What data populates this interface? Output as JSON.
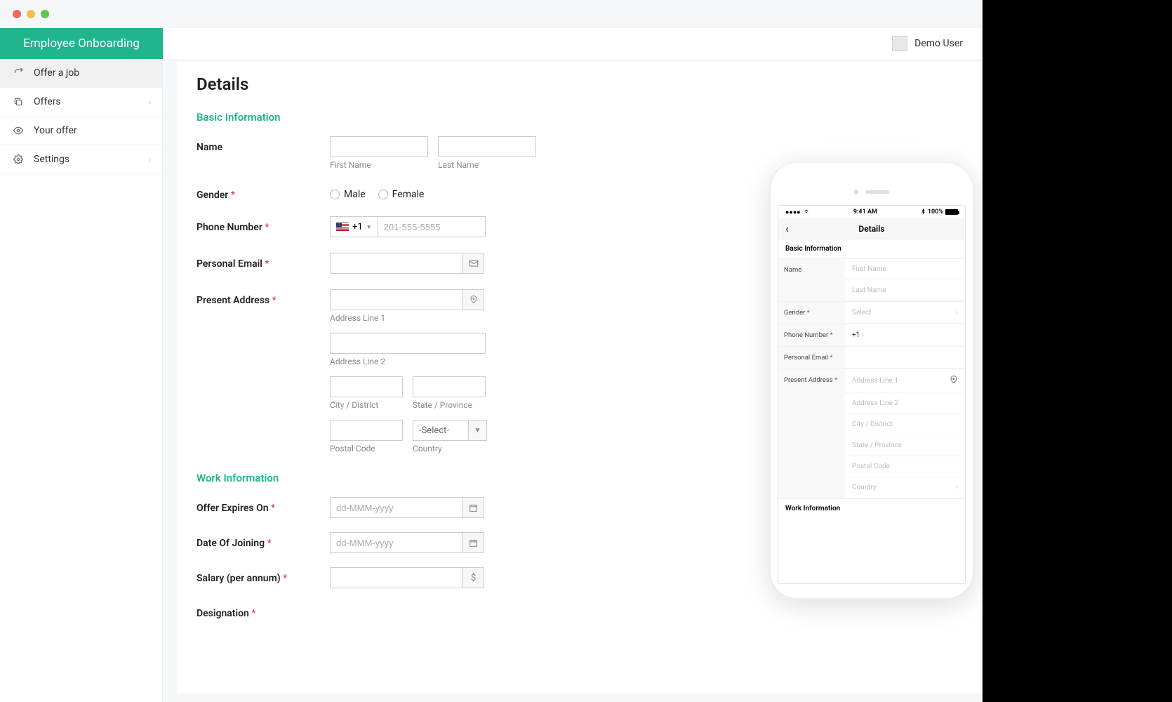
{
  "header": {
    "brand": "Employee Onboarding",
    "user": "Demo User"
  },
  "sidebar": {
    "items": [
      {
        "label": "Offer a job",
        "icon": "share"
      },
      {
        "label": "Offers",
        "icon": "copy",
        "chevron": true
      },
      {
        "label": "Your offer",
        "icon": "eye"
      },
      {
        "label": "Settings",
        "icon": "gears",
        "chevron": true
      }
    ]
  },
  "page": {
    "title": "Details",
    "sections": {
      "basic": {
        "title": "Basic Information",
        "name_label": "Name",
        "first_name_helper": "First Name",
        "last_name_helper": "Last Name",
        "gender_label": "Gender",
        "gender_male": "Male",
        "gender_female": "Female",
        "phone_label": "Phone Number",
        "phone_prefix": "+1",
        "phone_placeholder": "201-555-5555",
        "email_label": "Personal Email",
        "address_label": "Present Address",
        "addr1_helper": "Address Line 1",
        "addr2_helper": "Address Line 2",
        "city_helper": "City / District",
        "state_helper": "State / Province",
        "postal_helper": "Postal Code",
        "country_helper": "Country",
        "country_select": "-Select-"
      },
      "work": {
        "title": "Work Information",
        "expires_label": "Offer Expires On",
        "joining_label": "Date Of Joining",
        "salary_label": "Salary (per annum)",
        "designation_label": "Designation",
        "date_placeholder": "dd-MMM-yyyy"
      }
    }
  },
  "mobile": {
    "status": {
      "time": "9:41 AM",
      "battery": "100%"
    },
    "title": "Details",
    "basic_section": "Basic Information",
    "work_section": "Work Information",
    "name_label": "Name",
    "first_name_ph": "First Name",
    "last_name_ph": "Last Name",
    "gender_label": "Gender",
    "gender_ph": "Select",
    "phone_label": "Phone Number",
    "phone_ph": "+1",
    "email_label": "Personal Email",
    "address_label": "Present Address",
    "addr1_ph": "Address Line 1",
    "addr2_ph": "Address Line 2",
    "city_ph": "City / District",
    "state_ph": "State / Province",
    "postal_ph": "Postal Code",
    "country_ph": "Country"
  }
}
